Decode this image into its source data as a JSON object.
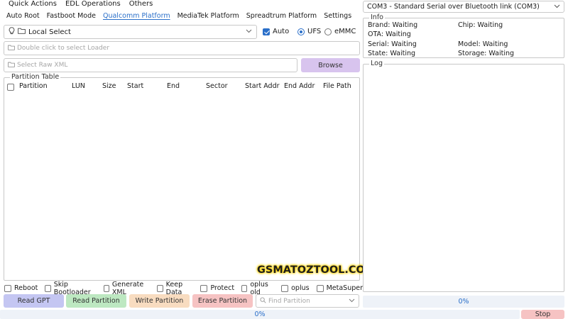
{
  "menu": [
    "Quick Actions",
    "EDL Operations",
    "Others"
  ],
  "tabs": [
    {
      "label": "Auto Root"
    },
    {
      "label": "Fastboot Mode"
    },
    {
      "label": "Qualcomm Platform"
    },
    {
      "label": "MediaTek Platform"
    },
    {
      "label": "Spreadtrum Platform"
    },
    {
      "label": "Settings"
    }
  ],
  "active_tab": "Qualcomm Platform",
  "loader": {
    "selected": "Local Select",
    "auto_label": "Auto",
    "auto_checked": true,
    "storage": [
      "UFS",
      "eMMC"
    ],
    "storage_selected": "UFS",
    "loader_placeholder": "Double click to select Loader",
    "xml_placeholder": "Select Raw XML",
    "browse_label": "Browse"
  },
  "partition_table": {
    "title": "Partition Table",
    "columns": [
      "Partition",
      "LUN",
      "Size",
      "Start",
      "End",
      "Sector",
      "Start Addr",
      "End Addr",
      "File Path"
    ],
    "rows": []
  },
  "watermark": "GSMATOZTOOL.COM",
  "options": [
    {
      "label": "Reboot",
      "checked": false
    },
    {
      "label": "Skip Bootloader",
      "checked": false
    },
    {
      "label": "Generate XML",
      "checked": false
    },
    {
      "label": "Keep Data",
      "checked": false
    },
    {
      "label": "Protect",
      "checked": false
    },
    {
      "label": "oplus old",
      "checked": false
    },
    {
      "label": "oplus",
      "checked": false
    },
    {
      "label": "MetaSuper",
      "checked": false
    }
  ],
  "actions": {
    "read_gpt": "Read GPT",
    "read_partition": "Read Partition",
    "write_partition": "Write Partition",
    "erase_partition": "Erase Partition",
    "find_placeholder": "Find Partition"
  },
  "progress_main": "0%",
  "port": "COM3 - Standard Serial over Bluetooth link (COM3)",
  "info": {
    "title": "Info",
    "brand": "Brand: Waiting",
    "chip": "Chip: Waiting",
    "ota": "OTA: Waiting",
    "serial": "Serial: Waiting",
    "model": "Model: Waiting",
    "state": "State: Waiting",
    "storage": "Storage: Waiting"
  },
  "log": {
    "title": "Log"
  },
  "progress_side": "0%",
  "stop_label": "Stop",
  "colors": {
    "accent": "#2a6fc9",
    "read_gpt": "#c4c6f2",
    "read_partition": "#bde8c1",
    "write_partition": "#f8dcc0",
    "erase_partition": "#f6c3c3",
    "browse": "#d8c4ee"
  }
}
